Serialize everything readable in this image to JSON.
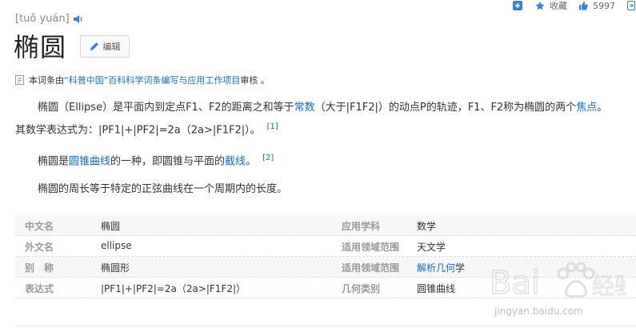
{
  "toolbar": {
    "add_label": "",
    "favorite_label": "收藏",
    "like_count": "5997"
  },
  "header": {
    "pinyin": "[tuǒ yuán]",
    "title": "椭圆",
    "edit_label": "编辑"
  },
  "review": {
    "prefix": "本词条由",
    "org": "“科普中国”百科科学词条编写与应用工作项目",
    "suffix": " 审核 。"
  },
  "body": {
    "p1_line1_a": "椭圆（Ellipse）是平面内到定点F1、F2的距离之和等于",
    "p1_link_constant": "常数",
    "p1_line1_b": "（大于|F1F2|）的动点P的轨迹，F1、F2称为椭圆的两个",
    "p1_link_focus": "焦点",
    "p1_line1_c": "。",
    "p1_line2": "其数学表达式为：|PF1|+|PF2|=2a（2a>|F1F2|）。",
    "p1_ref": "[1]",
    "p2_a": "椭圆是",
    "p2_link_conic": "圆锥曲线",
    "p2_b": "的一种，即圆锥与平面的",
    "p2_link_section": "截线",
    "p2_c": "。",
    "p2_ref": "[2]",
    "p3": "椭圆的周长等于特定的正弦曲线在一个周期内的长度。"
  },
  "info": [
    {
      "n1": "中文名",
      "v1": "椭圆",
      "n2": "应用学科",
      "v2": "数学",
      "v2_link": false
    },
    {
      "n1": "外文名",
      "v1": "ellipse",
      "n2": "适用领域范围",
      "v2": "天文学",
      "v2_link": false
    },
    {
      "n1": "别　称",
      "v1": "椭圆形",
      "n2": "适用领域范围",
      "v2": "解析几何",
      "v2_suffix": "学",
      "v2_link": true
    },
    {
      "n1": "表达式",
      "v1": "|PF1|+|PF2|=2a（2a>|F1F2|）",
      "n2": "几何类别",
      "v2": "圆锥曲线",
      "v2_link": false
    }
  ],
  "watermark": {
    "text": "jingyan.baidu.com"
  },
  "colors": {
    "link": "#136ec2",
    "label": "#999999",
    "text": "#333333"
  }
}
